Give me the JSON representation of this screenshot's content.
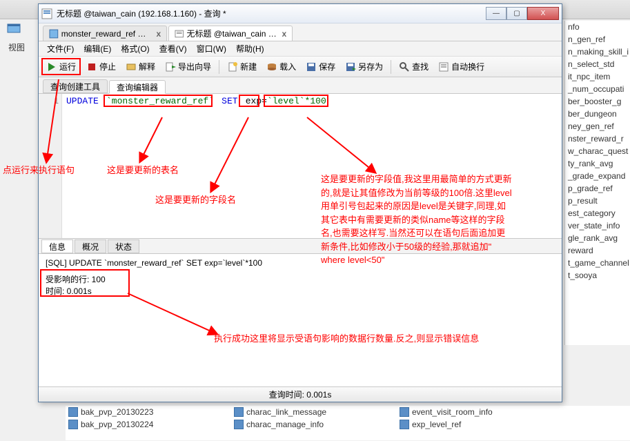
{
  "bg": {
    "view_label": "视图"
  },
  "window": {
    "title": "无标题 @taiwan_cain (192.168.1.160) - 查询 *",
    "min": "—",
    "max": "▢",
    "close": "X"
  },
  "doc_tabs": [
    {
      "label": "monster_reward_ref @t...",
      "close": "x"
    },
    {
      "label": "无标题 @taiwan_cain (1...",
      "close": "x"
    }
  ],
  "menus": [
    "文件(F)",
    "编辑(E)",
    "格式(O)",
    "查看(V)",
    "窗口(W)",
    "帮助(H)"
  ],
  "toolbar": {
    "run": "运行",
    "stop": "停止",
    "explain": "解释",
    "export": "导出向导",
    "new": "新建",
    "load": "载入",
    "save": "保存",
    "saveas": "另存为",
    "search": "查找",
    "wrap": "自动换行"
  },
  "sub_tabs": {
    "builder": "查询创建工具",
    "editor": "查询编辑器"
  },
  "sql": {
    "line_no": "1",
    "kw_update": "UPDATE",
    "table": "`monster_reward_ref`",
    "kw_set": "SET",
    "col": "exp",
    "eq": "=",
    "expr": "`level`*100"
  },
  "annotations": {
    "run_hint": "点运行来执行语句",
    "table_hint": "这是要更新的表名",
    "col_hint": "这是要更新的字段名",
    "expr_hint": "这是要更新的字段值,我这里用最简单的方式更新的,就是让其值修改为当前等级的100倍.这里level用单引号包起来的原因是level是关键字,同理,如其它表中有需要更新的类似name等这样的字段名,也需要这样写.当然还可以在语句后面追加更新条件,比如修改小于50级的经验,那就追加\" where level<50\"",
    "result_hint": "执行成功这里将显示受语句影响的数据行数量.反之,则显示错误信息"
  },
  "result_tabs": {
    "info": "信息",
    "summary": "概况",
    "status": "状态"
  },
  "result": {
    "sql_echo": "[SQL] UPDATE `monster_reward_ref` SET exp=`level`*100",
    "affected": "受影响的行: 100",
    "time": "时间: 0.001s"
  },
  "statusbar": {
    "query_time": "查询时间: 0.001s"
  },
  "side_items": [
    "nfo",
    "n_gen_ref",
    "n_making_skill_i",
    "n_select_std",
    "it_npc_item",
    "_num_occupati",
    "ber_booster_g",
    "ber_dungeon",
    "ney_gen_ref",
    "nster_reward_r",
    "w_charac_quest",
    "ty_rank_avg",
    "_grade_expand",
    "p_grade_ref",
    "p_result",
    "est_category",
    "ver_state_info",
    "gle_rank_avg",
    "reward",
    "t_game_channel",
    "t_sooya"
  ],
  "bottom_files": [
    [
      "bak_pvp_20130223",
      "charac_link_message",
      "event_visit_room_info"
    ],
    [
      "bak_pvp_20130224",
      "charac_manage_info",
      "exp_level_ref"
    ]
  ]
}
